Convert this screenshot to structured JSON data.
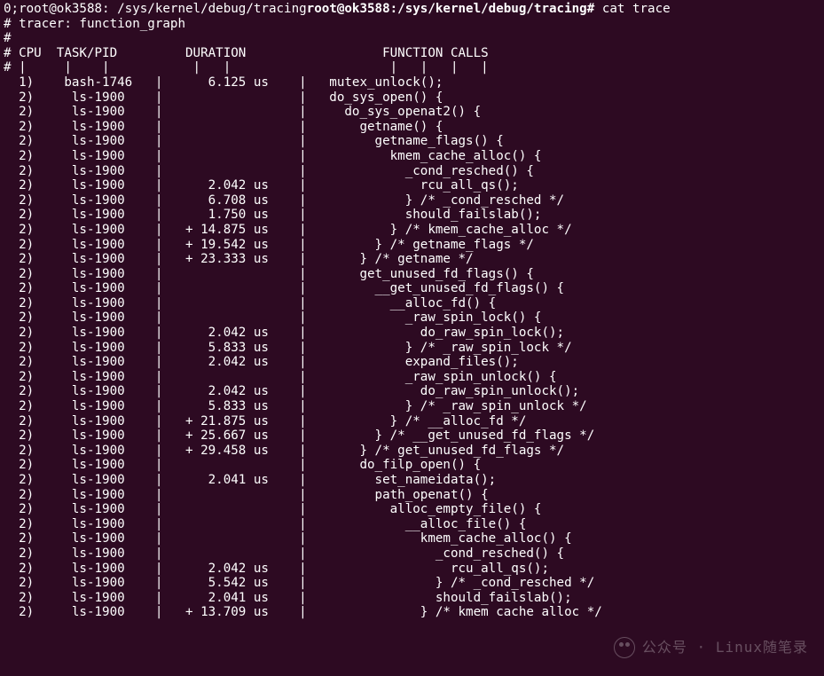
{
  "prompt": {
    "desc": "0;root@ok3588: /sys/kernel/debug/tracing",
    "bold": "root@ok3588:/sys/kernel/debug/tracing#",
    "command": "cat trace"
  },
  "header_lines": [
    "# tracer: function_graph",
    "#",
    "# CPU  TASK/PID         DURATION                  FUNCTION CALLS",
    "# |     |    |           |   |                     |   |   |   |"
  ],
  "trace": [
    {
      "cpu": " 1)",
      "task": "   bash-1746 ",
      "dur": "   6.125 us ",
      "func": "  mutex_unlock();"
    },
    {
      "cpu": " 2)",
      "task": "    ls-1900  ",
      "dur": "            ",
      "func": "  do_sys_open() {"
    },
    {
      "cpu": " 2)",
      "task": "    ls-1900  ",
      "dur": "            ",
      "func": "    do_sys_openat2() {"
    },
    {
      "cpu": " 2)",
      "task": "    ls-1900  ",
      "dur": "            ",
      "func": "      getname() {"
    },
    {
      "cpu": " 2)",
      "task": "    ls-1900  ",
      "dur": "            ",
      "func": "        getname_flags() {"
    },
    {
      "cpu": " 2)",
      "task": "    ls-1900  ",
      "dur": "            ",
      "func": "          kmem_cache_alloc() {"
    },
    {
      "cpu": " 2)",
      "task": "    ls-1900  ",
      "dur": "            ",
      "func": "            _cond_resched() {"
    },
    {
      "cpu": " 2)",
      "task": "    ls-1900  ",
      "dur": "   2.042 us ",
      "func": "              rcu_all_qs();"
    },
    {
      "cpu": " 2)",
      "task": "    ls-1900  ",
      "dur": "   6.708 us ",
      "func": "            } /* _cond_resched */"
    },
    {
      "cpu": " 2)",
      "task": "    ls-1900  ",
      "dur": "   1.750 us ",
      "func": "            should_failslab();"
    },
    {
      "cpu": " 2)",
      "task": "    ls-1900  ",
      "dur": " + 14.875 us ",
      "func": "          } /* kmem_cache_alloc */"
    },
    {
      "cpu": " 2)",
      "task": "    ls-1900  ",
      "dur": " + 19.542 us ",
      "func": "        } /* getname_flags */"
    },
    {
      "cpu": " 2)",
      "task": "    ls-1900  ",
      "dur": " + 23.333 us ",
      "func": "      } /* getname */"
    },
    {
      "cpu": " 2)",
      "task": "    ls-1900  ",
      "dur": "            ",
      "func": "      get_unused_fd_flags() {"
    },
    {
      "cpu": " 2)",
      "task": "    ls-1900  ",
      "dur": "            ",
      "func": "        __get_unused_fd_flags() {"
    },
    {
      "cpu": " 2)",
      "task": "    ls-1900  ",
      "dur": "            ",
      "func": "          __alloc_fd() {"
    },
    {
      "cpu": " 2)",
      "task": "    ls-1900  ",
      "dur": "            ",
      "func": "            _raw_spin_lock() {"
    },
    {
      "cpu": " 2)",
      "task": "    ls-1900  ",
      "dur": "   2.042 us ",
      "func": "              do_raw_spin_lock();"
    },
    {
      "cpu": " 2)",
      "task": "    ls-1900  ",
      "dur": "   5.833 us ",
      "func": "            } /* _raw_spin_lock */"
    },
    {
      "cpu": " 2)",
      "task": "    ls-1900  ",
      "dur": "   2.042 us ",
      "func": "            expand_files();"
    },
    {
      "cpu": " 2)",
      "task": "    ls-1900  ",
      "dur": "            ",
      "func": "            _raw_spin_unlock() {"
    },
    {
      "cpu": " 2)",
      "task": "    ls-1900  ",
      "dur": "   2.042 us ",
      "func": "              do_raw_spin_unlock();"
    },
    {
      "cpu": " 2)",
      "task": "    ls-1900  ",
      "dur": "   5.833 us ",
      "func": "            } /* _raw_spin_unlock */"
    },
    {
      "cpu": " 2)",
      "task": "    ls-1900  ",
      "dur": " + 21.875 us ",
      "func": "          } /* __alloc_fd */"
    },
    {
      "cpu": " 2)",
      "task": "    ls-1900  ",
      "dur": " + 25.667 us ",
      "func": "        } /* __get_unused_fd_flags */"
    },
    {
      "cpu": " 2)",
      "task": "    ls-1900  ",
      "dur": " + 29.458 us ",
      "func": "      } /* get_unused_fd_flags */"
    },
    {
      "cpu": " 2)",
      "task": "    ls-1900  ",
      "dur": "            ",
      "func": "      do_filp_open() {"
    },
    {
      "cpu": " 2)",
      "task": "    ls-1900  ",
      "dur": "   2.041 us ",
      "func": "        set_nameidata();"
    },
    {
      "cpu": " 2)",
      "task": "    ls-1900  ",
      "dur": "            ",
      "func": "        path_openat() {"
    },
    {
      "cpu": " 2)",
      "task": "    ls-1900  ",
      "dur": "            ",
      "func": "          alloc_empty_file() {"
    },
    {
      "cpu": " 2)",
      "task": "    ls-1900  ",
      "dur": "            ",
      "func": "            __alloc_file() {"
    },
    {
      "cpu": " 2)",
      "task": "    ls-1900  ",
      "dur": "            ",
      "func": "              kmem_cache_alloc() {"
    },
    {
      "cpu": " 2)",
      "task": "    ls-1900  ",
      "dur": "            ",
      "func": "                _cond_resched() {"
    },
    {
      "cpu": " 2)",
      "task": "    ls-1900  ",
      "dur": "   2.042 us ",
      "func": "                  rcu_all_qs();"
    },
    {
      "cpu": " 2)",
      "task": "    ls-1900  ",
      "dur": "   5.542 us ",
      "func": "                } /* _cond_resched */"
    },
    {
      "cpu": " 2)",
      "task": "    ls-1900  ",
      "dur": "   2.041 us ",
      "func": "                should_failslab();"
    },
    {
      "cpu": " 2)",
      "task": "    ls-1900  ",
      "dur": " + 13.709 us ",
      "func": "              } /* kmem cache alloc */"
    }
  ],
  "watermark": "公众号 · Linux随笔录"
}
